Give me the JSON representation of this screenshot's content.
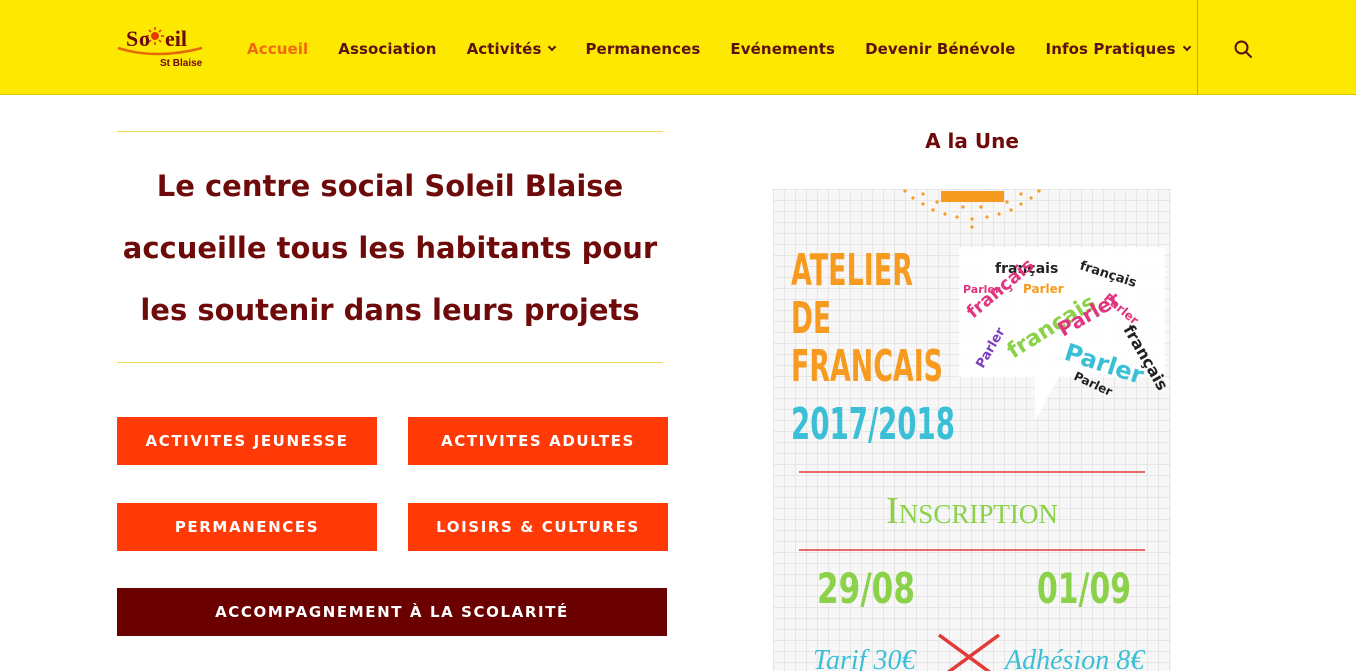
{
  "logo": {
    "text": "Soleil",
    "subtext": "St Blaise"
  },
  "nav": {
    "items": [
      {
        "label": "Accueil",
        "active": true
      },
      {
        "label": "Association"
      },
      {
        "label": "Activités",
        "dropdown": true
      },
      {
        "label": "Permanences"
      },
      {
        "label": "Evénements"
      },
      {
        "label": "Devenir Bénévole"
      },
      {
        "label": "Infos Pratiques",
        "dropdown": true
      }
    ],
    "search_icon": "search-icon"
  },
  "hero": {
    "line1": "Le centre social Soleil Blaise",
    "line2": "accueille tous les habitants pour",
    "line3": "les soutenir dans leurs projets"
  },
  "buttons": {
    "jeunesse": "ACTIVITES JEUNESSE",
    "adultes": "ACTIVITES ADULTES",
    "permanences": "PERMANENCES",
    "loisirs": "LOISIRS & CULTURES",
    "scolarite": "ACCOMPAGNEMENT À LA SCOLARITÉ"
  },
  "une": {
    "title": "A la Une",
    "poster": {
      "line1": "ATELIER",
      "line2": "DE",
      "line3": "FRANCAIS",
      "year": "2017/2018",
      "inscription": "Inscription",
      "date1": "29/08",
      "date2": "01/09",
      "tarif": "Tarif 30€",
      "adhesion": "Adhésion 8€",
      "cloud_words": [
        "français",
        "Parler"
      ]
    }
  },
  "colors": {
    "header_bg": "#fde800",
    "nav_text": "#5b1212",
    "nav_active": "#f06a0c",
    "button_orange": "#ff3a06",
    "button_dark": "#6a0000",
    "heading": "#6e0a0a"
  }
}
